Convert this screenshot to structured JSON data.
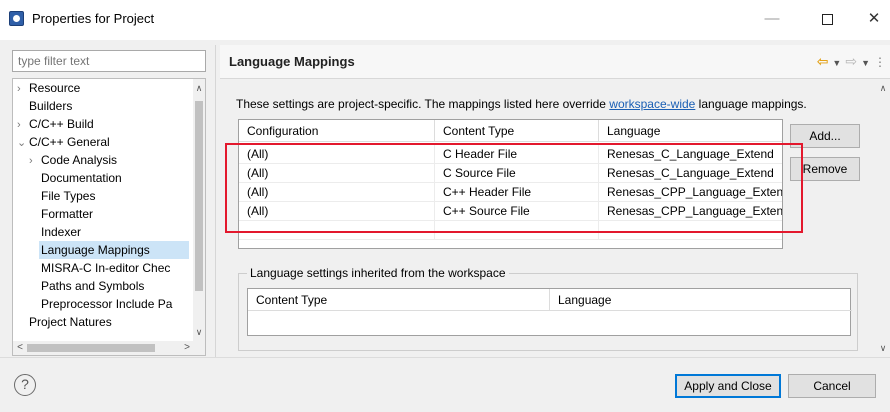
{
  "window": {
    "title": "Properties for Project",
    "minimize_glyph": "—",
    "close_glyph": "✕"
  },
  "sidebar": {
    "filter_placeholder": "type filter text",
    "items": [
      {
        "label": "Resource",
        "arrow": "›"
      },
      {
        "label": "Builders",
        "arrow": ""
      },
      {
        "label": "C/C++ Build",
        "arrow": "›"
      },
      {
        "label": "C/C++ General",
        "arrow": "⌄"
      },
      {
        "label": "Code Analysis",
        "arrow": "›"
      },
      {
        "label": "Documentation",
        "arrow": ""
      },
      {
        "label": "File Types",
        "arrow": ""
      },
      {
        "label": "Formatter",
        "arrow": ""
      },
      {
        "label": "Indexer",
        "arrow": ""
      },
      {
        "label": "Language Mappings",
        "arrow": ""
      },
      {
        "label": "MISRA-C In-editor Chec",
        "arrow": ""
      },
      {
        "label": "Paths and Symbols",
        "arrow": ""
      },
      {
        "label": "Preprocessor Include Pa",
        "arrow": ""
      },
      {
        "label": "Project Natures",
        "arrow": ""
      }
    ],
    "selected": "Language Mappings"
  },
  "pane": {
    "title": "Language Mappings",
    "nav": {
      "back": "⇦",
      "drop": "▼",
      "forward": "⇨",
      "menu": "⋮"
    }
  },
  "content": {
    "description_before": "These settings are project-specific.  The mappings listed here override ",
    "description_link": "workspace-wide",
    "description_after": " language mappings.",
    "mappings_table": {
      "headers": [
        "Configuration",
        "Content Type",
        "Language"
      ],
      "rows": [
        [
          "(All)",
          "C Header File",
          "Renesas_C_Language_Extend"
        ],
        [
          "(All)",
          "C Source File",
          "Renesas_C_Language_Extend"
        ],
        [
          "(All)",
          "C++ Header File",
          "Renesas_CPP_Language_Extend"
        ],
        [
          "(All)",
          "C++ Source File",
          "Renesas_CPP_Language_Extend"
        ]
      ]
    },
    "add_label": "Add...",
    "remove_label": "Remove",
    "inherited": {
      "title": "Language settings inherited from the workspace",
      "headers": [
        "Content Type",
        "Language"
      ]
    }
  },
  "footer": {
    "help_glyph": "?",
    "apply_label": "Apply and Close",
    "cancel_label": "Cancel"
  },
  "colors": {
    "highlight": "#e3182d",
    "selection": "#cce4f7",
    "link": "#1a5fb4",
    "default_button_border": "#0078d7"
  }
}
